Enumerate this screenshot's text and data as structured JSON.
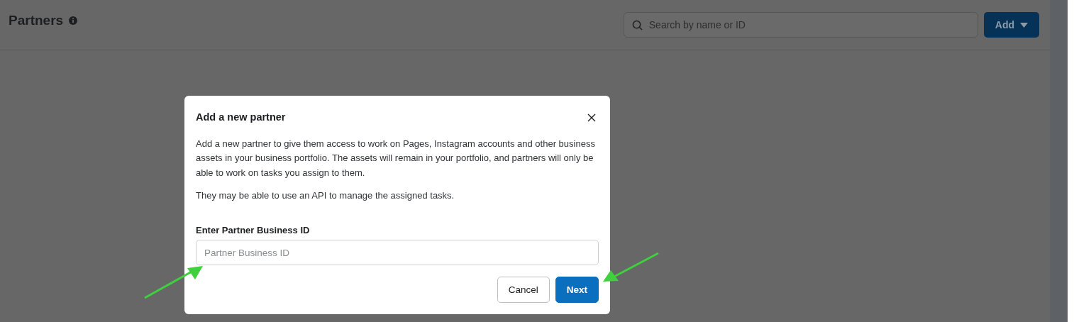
{
  "page": {
    "title": "Partners",
    "search": {
      "placeholder": "Search by name or ID"
    },
    "add_button": "Add"
  },
  "dialog": {
    "title": "Add a new partner",
    "paragraphs": [
      "Add a new partner to give them access to work on Pages, Instagram accounts and other business assets in your business portfolio. The assets will remain in your portfolio, and partners will only be able to work on tasks you assign to them.",
      "They may be able to use an API to manage the assigned tasks."
    ],
    "field": {
      "label": "Enter Partner Business ID",
      "placeholder": "Partner Business ID"
    },
    "buttons": [
      {
        "label": "Cancel",
        "kind": "secondary"
      },
      {
        "label": "Next",
        "kind": "primary"
      }
    ]
  }
}
